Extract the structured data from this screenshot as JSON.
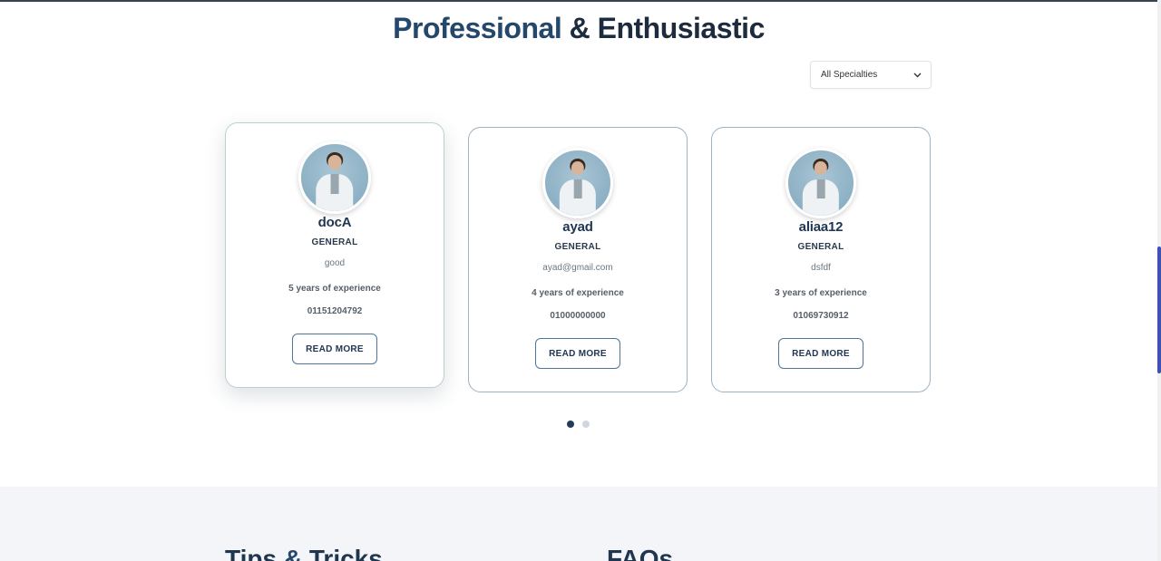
{
  "section": {
    "title_part1": "Professional",
    "title_part2": "& Enthusiastic"
  },
  "filter": {
    "selected": "All Specialties",
    "icon": "chevron-down-icon"
  },
  "doctors": [
    {
      "name": "docA",
      "specialty": "GENERAL",
      "bio": "good",
      "experience": "5 years of experience",
      "phone": "01151204792",
      "button": "READ MORE"
    },
    {
      "name": "ayad",
      "specialty": "GENERAL",
      "bio": "ayad@gmail.com",
      "experience": "4 years of experience",
      "phone": "01000000000",
      "button": "READ MORE"
    },
    {
      "name": "aliaa12",
      "specialty": "GENERAL",
      "bio": "dsfdf",
      "experience": "3 years of experience",
      "phone": "01069730912",
      "button": "READ MORE"
    }
  ],
  "pagination": {
    "pages": 2,
    "current": 1
  },
  "lower": {
    "tips_part1": "Tips",
    "tips_amp": "&",
    "tips_part2": "Tricks",
    "faq": "FAQs"
  },
  "colors": {
    "accent": "#24486b",
    "scrollbar": "#3f51b5"
  }
}
